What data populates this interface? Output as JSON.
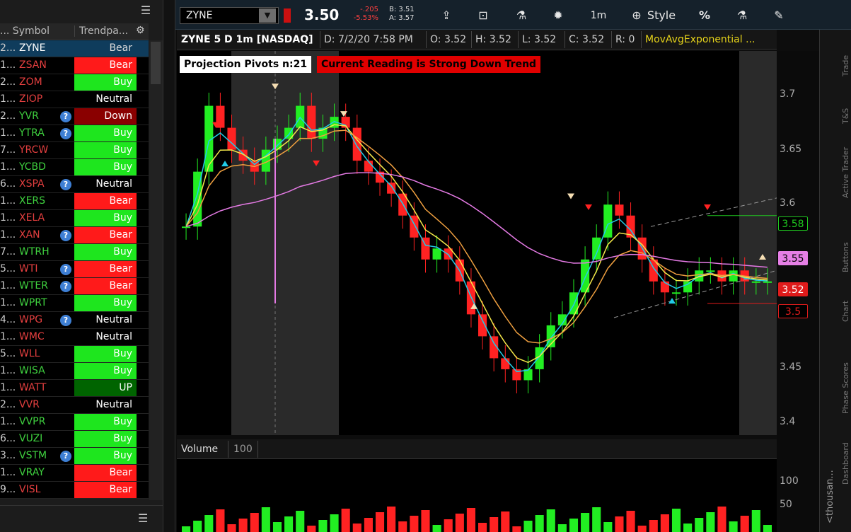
{
  "watchlist": {
    "col_symbol": "... Symbol",
    "col_trend": "Trendpa...",
    "rows": [
      {
        "prefix": "2...",
        "symbol": "ZYNE",
        "sym_color": "white",
        "info": false,
        "trend": "Bear",
        "trend_style": "t-neutral",
        "selected": true
      },
      {
        "prefix": "1...",
        "symbol": "ZSAN",
        "sym_color": "red",
        "info": false,
        "trend": "Bear",
        "trend_style": "t-bear"
      },
      {
        "prefix": "2...",
        "symbol": "ZOM",
        "sym_color": "red",
        "info": false,
        "trend": "Buy",
        "trend_style": "t-buy"
      },
      {
        "prefix": "1...",
        "symbol": "ZIOP",
        "sym_color": "red",
        "info": false,
        "trend": "Neutral",
        "trend_style": "t-neutral"
      },
      {
        "prefix": "2...",
        "symbol": "YVR",
        "sym_color": "green",
        "info": true,
        "trend": "Down",
        "trend_style": "t-down"
      },
      {
        "prefix": "1...",
        "symbol": "YTRA",
        "sym_color": "green",
        "info": true,
        "trend": "Buy",
        "trend_style": "t-buy"
      },
      {
        "prefix": "7...",
        "symbol": "YRCW",
        "sym_color": "red",
        "info": false,
        "trend": "Buy",
        "trend_style": "t-buy"
      },
      {
        "prefix": "1...",
        "symbol": "YCBD",
        "sym_color": "green",
        "info": false,
        "trend": "Buy",
        "trend_style": "t-buy"
      },
      {
        "prefix": "6...",
        "symbol": "XSPA",
        "sym_color": "red",
        "info": true,
        "trend": "Neutral",
        "trend_style": "t-neutral"
      },
      {
        "prefix": "1...",
        "symbol": "XERS",
        "sym_color": "green",
        "info": false,
        "trend": "Bear",
        "trend_style": "t-bear"
      },
      {
        "prefix": "1...",
        "symbol": "XELA",
        "sym_color": "red",
        "info": false,
        "trend": "Buy",
        "trend_style": "t-buy"
      },
      {
        "prefix": "1...",
        "symbol": "XAN",
        "sym_color": "red",
        "info": true,
        "trend": "Bear",
        "trend_style": "t-bear"
      },
      {
        "prefix": "7...",
        "symbol": "WTRH",
        "sym_color": "green",
        "info": false,
        "trend": "Buy",
        "trend_style": "t-buy"
      },
      {
        "prefix": "5...",
        "symbol": "WTI",
        "sym_color": "red",
        "info": true,
        "trend": "Bear",
        "trend_style": "t-bear"
      },
      {
        "prefix": "1...",
        "symbol": "WTER",
        "sym_color": "green",
        "info": true,
        "trend": "Bear",
        "trend_style": "t-bear"
      },
      {
        "prefix": "1...",
        "symbol": "WPRT",
        "sym_color": "green",
        "info": false,
        "trend": "Buy",
        "trend_style": "t-buy"
      },
      {
        "prefix": "4...",
        "symbol": "WPG",
        "sym_color": "red",
        "info": true,
        "trend": "Neutral",
        "trend_style": "t-neutral"
      },
      {
        "prefix": "1...",
        "symbol": "WMC",
        "sym_color": "red",
        "info": false,
        "trend": "Neutral",
        "trend_style": "t-neutral"
      },
      {
        "prefix": "5...",
        "symbol": "WLL",
        "sym_color": "red",
        "info": false,
        "trend": "Buy",
        "trend_style": "t-buy"
      },
      {
        "prefix": "1...",
        "symbol": "WISA",
        "sym_color": "green",
        "info": false,
        "trend": "Buy",
        "trend_style": "t-buy"
      },
      {
        "prefix": "1...",
        "symbol": "WATT",
        "sym_color": "red",
        "info": false,
        "trend": "UP",
        "trend_style": "t-up"
      },
      {
        "prefix": "2...",
        "symbol": "VVR",
        "sym_color": "red",
        "info": false,
        "trend": "Neutral",
        "trend_style": "t-neutral"
      },
      {
        "prefix": "1...",
        "symbol": "VVPR",
        "sym_color": "green",
        "info": false,
        "trend": "Buy",
        "trend_style": "t-buy"
      },
      {
        "prefix": "6...",
        "symbol": "VUZI",
        "sym_color": "green",
        "info": false,
        "trend": "Buy",
        "trend_style": "t-buy"
      },
      {
        "prefix": "3...",
        "symbol": "VSTM",
        "sym_color": "green",
        "info": true,
        "trend": "Buy",
        "trend_style": "t-buy"
      },
      {
        "prefix": "1...",
        "symbol": "VRAY",
        "sym_color": "green",
        "info": false,
        "trend": "Bear",
        "trend_style": "t-bear"
      },
      {
        "prefix": "9...",
        "symbol": "VISL",
        "sym_color": "red",
        "info": false,
        "trend": "Bear",
        "trend_style": "t-bear"
      }
    ]
  },
  "toolbar": {
    "symbol": "ZYNE",
    "last": "3.50",
    "change": "-.205",
    "change_pct": "-5.53%",
    "bid": "B: 3.51",
    "ask": "A: 3.57",
    "interval": "1m",
    "style_label": "Style"
  },
  "chart_header": {
    "title": "ZYNE 5 D 1m [NASDAQ]",
    "date": "D: 7/2/20 7:58 PM",
    "open": "O: 3.52",
    "high": "H: 3.52",
    "low": "L: 3.52",
    "close": "C: 3.52",
    "range": "R: 0",
    "study": "MovAvgExponential ..."
  },
  "badges": {
    "projection": "Projection Pivots n:21",
    "reading": "Current Reading is Strong Down Trend"
  },
  "price_axis": {
    "ticks": [
      "3.7",
      "3.65",
      "3.6",
      "3.45",
      "3.4"
    ],
    "labels": [
      {
        "text": "3.58",
        "color": "#1fc81f",
        "bg": "#000",
        "border": "#1fc81f"
      },
      {
        "text": "3.55",
        "color": "#000",
        "bg": "#e57fe5",
        "border": "#e57fe5"
      },
      {
        "text": "3.52",
        "color": "#fff",
        "bg": "#e01b1b",
        "border": "#e01b1b"
      },
      {
        "text": "3.5",
        "color": "#e01b1b",
        "bg": "#000",
        "border": "#e01b1b"
      }
    ]
  },
  "volume": {
    "label": "Volume",
    "period": "100",
    "ticks": [
      "100",
      "50"
    ],
    "unit": "<thousan..."
  },
  "right_tabs": [
    "Trade",
    "T&S",
    "Active Trader",
    "Buttons",
    "Chart",
    "Phase Scores",
    "Dashboard"
  ],
  "chart_data": {
    "type": "candlestick",
    "x": [],
    "series": [
      {
        "values": [
          3.57,
          3.62,
          3.68,
          3.66,
          3.64,
          3.63,
          3.62,
          3.64,
          3.65,
          3.66,
          3.68,
          3.65,
          3.66,
          3.67,
          3.66,
          3.63,
          3.62,
          3.61,
          3.6,
          3.58,
          3.56,
          3.54,
          3.55,
          3.54,
          3.52,
          3.49,
          3.47,
          3.45,
          3.44,
          3.43,
          3.44,
          3.46,
          3.48,
          3.49,
          3.51,
          3.54,
          3.56,
          3.59,
          3.58,
          3.56,
          3.54,
          3.52,
          3.51,
          3.51,
          3.52,
          3.53,
          3.53,
          3.52,
          3.53,
          3.52,
          3.52,
          3.52
        ]
      }
    ],
    "ylim": [
      3.38,
      3.73
    ]
  }
}
